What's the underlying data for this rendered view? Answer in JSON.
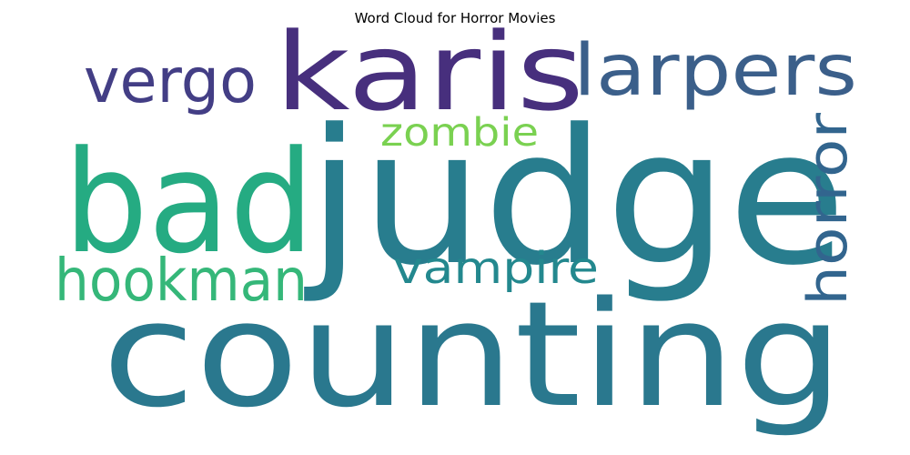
{
  "title": "Word Cloud for Horror Movies",
  "words": [
    {
      "text": "judge",
      "color": "#287d8e"
    },
    {
      "text": "counting",
      "color": "#2a788e"
    },
    {
      "text": "bad",
      "color": "#25ab82"
    },
    {
      "text": "karis",
      "color": "#472f7d"
    },
    {
      "text": "larpers",
      "color": "#3b5f8a"
    },
    {
      "text": "vergo",
      "color": "#433e85"
    },
    {
      "text": "hookman",
      "color": "#35b779"
    },
    {
      "text": "vampire",
      "color": "#23888e"
    },
    {
      "text": "zombie",
      "color": "#7ad151"
    },
    {
      "text": "horror",
      "color": "#32658e"
    }
  ]
}
